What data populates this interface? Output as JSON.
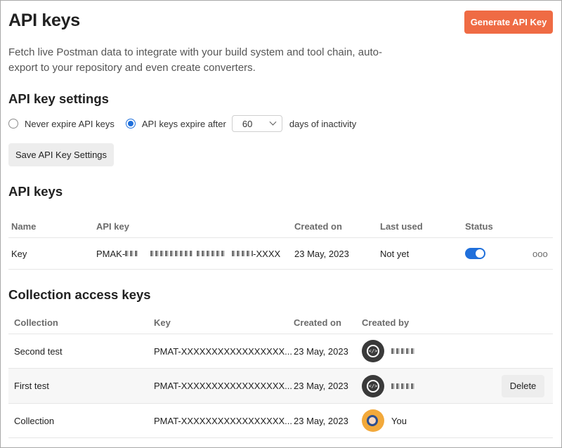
{
  "header": {
    "title": "API keys",
    "generate_label": "Generate API Key",
    "description": "Fetch live Postman data to integrate with your build system and tool chain, auto-export to your repository and even create converters."
  },
  "settings": {
    "title": "API key settings",
    "never_expire_label": "Never expire API keys",
    "expire_after_label": "API keys expire after",
    "days_value": "60",
    "days_suffix": "days of inactivity",
    "selected": "expire_after",
    "save_label": "Save API Key Settings"
  },
  "api_keys": {
    "title": "API keys",
    "columns": [
      "Name",
      "API key",
      "Created on",
      "Last used",
      "Status"
    ],
    "rows": [
      {
        "name": "Key",
        "key_prefix": "PMAK-",
        "key_suffix": "-XXXX",
        "created_on": "23 May, 2023",
        "last_used": "Not yet",
        "status_enabled": true,
        "more_label": "ooo"
      }
    ]
  },
  "collection_keys": {
    "title": "Collection access keys",
    "columns": [
      "Collection",
      "Key",
      "Created on",
      "Created by"
    ],
    "rows": [
      {
        "collection": "Second test",
        "key": "PMAT-XXXXXXXXXXXXXXXXX...",
        "created_on": "23 May, 2023",
        "created_by": "",
        "avatar": "postman-dev-avatar-icon"
      },
      {
        "collection": "First test",
        "key": "PMAT-XXXXXXXXXXXXXXXXX...",
        "created_on": "23 May, 2023",
        "created_by": "",
        "avatar": "postman-dev-avatar-icon",
        "delete_label": "Delete"
      },
      {
        "collection": "Collection",
        "key": "PMAT-XXXXXXXXXXXXXXXXX...",
        "created_on": "23 May, 2023",
        "created_by": "You",
        "avatar": "user-avatar-icon"
      }
    ]
  },
  "colors": {
    "accent_orange": "#ef6b44",
    "accent_blue": "#1f6fdb"
  }
}
